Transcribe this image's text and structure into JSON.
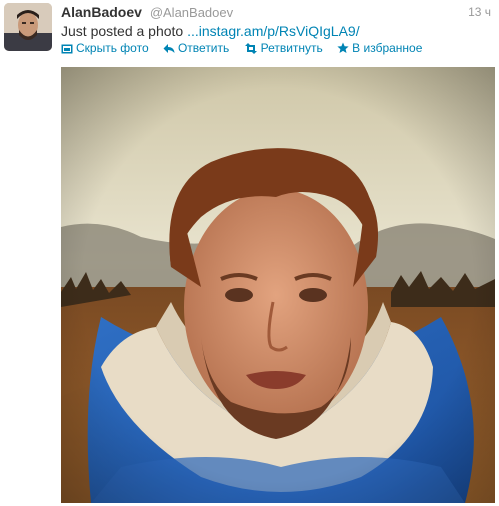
{
  "tweet": {
    "fullname": "AlanBadoev",
    "username": "@AlanBadoev",
    "timestamp": "13 ч",
    "text": "Just posted a photo",
    "link_text": "instagr.am/p/RsViQIgLA9/",
    "link_prefix": "..."
  },
  "actions": {
    "hide_photo": "Скрыть фото",
    "reply": "Ответить",
    "retweet": "Ретвитнуть",
    "favorite": "В избранное"
  },
  "icons": {
    "photo": "photo-icon",
    "reply": "reply-arrow-icon",
    "retweet": "retweet-icon",
    "favorite": "star-icon"
  },
  "colors": {
    "link": "#0084b4",
    "meta": "#999999",
    "text": "#333333"
  }
}
